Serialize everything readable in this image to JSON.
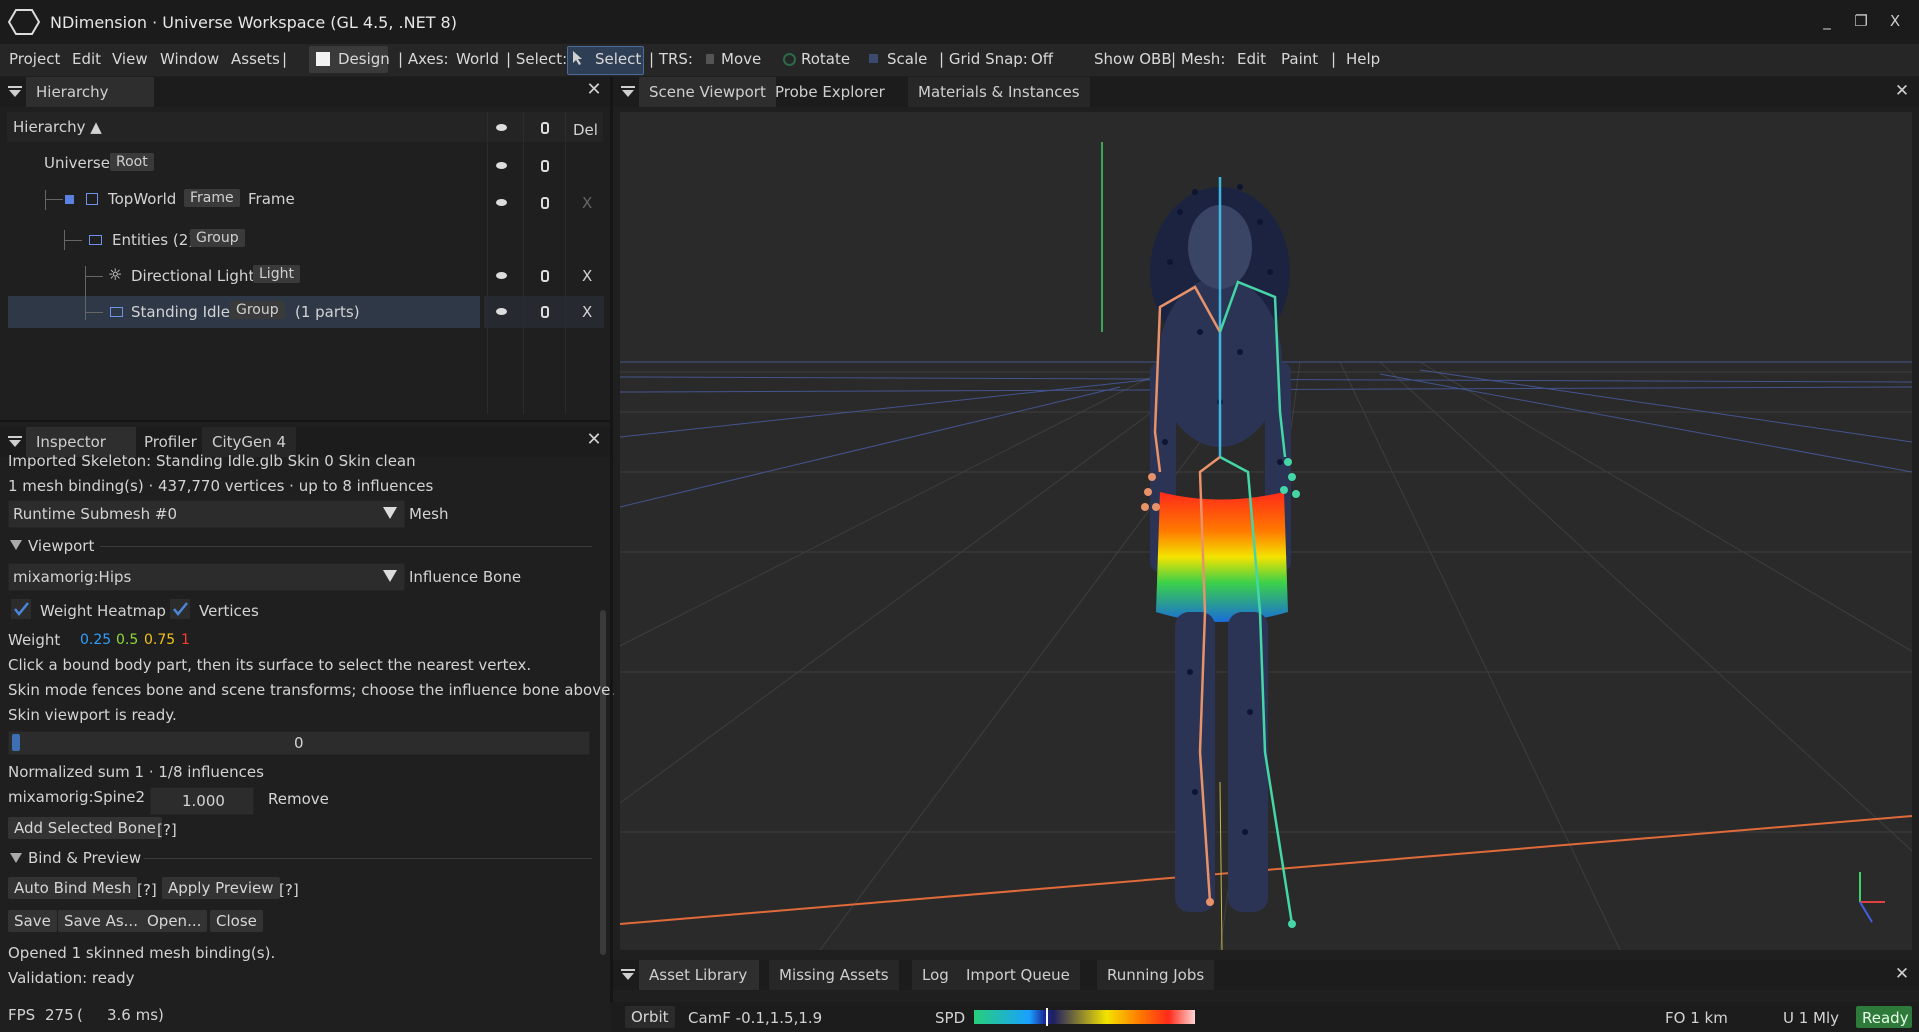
{
  "window": {
    "title": "NDimension · Universe Workspace (GL 4.5, .NET 8)",
    "minimize": "_",
    "restore": "❐",
    "close": "X"
  },
  "menu": {
    "project": "Project",
    "edit": "Edit",
    "view": "View",
    "window": "Window",
    "assets": "Assets",
    "sep": "|",
    "design": "Design",
    "axes_label": "| Axes:",
    "axes_value": "World",
    "select_label": "| Select:",
    "select_value": "Select",
    "trs_label": "| TRS:",
    "move": "Move",
    "rotate": "Rotate",
    "scale": "Scale",
    "grid_label": "| Grid Snap:",
    "grid_value": "Off",
    "show_obb": "Show OBB",
    "mesh_label": "| Mesh:",
    "mesh_edit": "Edit",
    "paint": "Paint",
    "help_sep": "|",
    "help": "Help"
  },
  "hierarchy": {
    "tab": "Hierarchy",
    "header": "Hierarchy ▲",
    "del": "Del",
    "rows": [
      {
        "name": "Universe",
        "chip": "Root",
        "extra": ""
      },
      {
        "name": "TopWorld",
        "chip": "Frame",
        "extra": "Frame",
        "x": "X"
      },
      {
        "name": "Entities (2)",
        "chip": "Group",
        "extra": ""
      },
      {
        "name": "Directional Light",
        "chip": "Light",
        "extra": "",
        "x": "X"
      },
      {
        "name": "Standing Idle",
        "chip": "Group",
        "extra": "(1 parts)",
        "x": "X"
      }
    ]
  },
  "inspector": {
    "tabs": [
      "Inspector",
      "Profiler",
      "CityGen 4"
    ],
    "skeleton_line": "Imported Skeleton: Standing Idle.glb Skin 0 Skin  clean",
    "binding_line": "1 mesh binding(s) · 437,770 vertices · up to 8 influences",
    "submesh_value": "Runtime Submesh #0",
    "submesh_label": "Mesh",
    "viewport_section": "Viewport",
    "bone_value": "mixamorig:Hips",
    "bone_label": "Influence Bone",
    "heatmap_label": "Weight Heatmap",
    "vertices_label": "Vertices",
    "weight_label": "Weight",
    "weight_stops": [
      {
        "label": "0.25",
        "color": "#2f9fff"
      },
      {
        "label": "0.5",
        "color": "#8fd93a"
      },
      {
        "label": "0.75",
        "color": "#f0c419"
      },
      {
        "label": "1",
        "color": "#ff3b30"
      }
    ],
    "help1": "Click a bound body part, then its surface to select the nearest vertex.",
    "help2": "Skin mode fences bone and scene transforms; choose the influence bone above.",
    "ready": "Skin viewport is ready.",
    "slider_value": "0",
    "normalized": "Normalized sum 1 · 1/8 influences",
    "influence_bone": "mixamorig:Spine2",
    "influence_weight": "1.000",
    "remove": "Remove",
    "add_selected": "Add Selected Bone",
    "q": "[?]",
    "bind_section": "Bind & Preview",
    "auto_bind": "Auto Bind Mesh",
    "apply_preview": "Apply Preview",
    "save": "Save",
    "save_as": "Save As...",
    "open": "Open...",
    "close": "Close",
    "opened": "Opened 1 skinned mesh binding(s).",
    "validation": "Validation: ready"
  },
  "fps": {
    "label": "FPS",
    "value": "275",
    "paren": "(",
    "ms": "3.6 ms)"
  },
  "viewport_tabs": [
    "Scene Viewport",
    "Probe Explorer",
    "Materials & Instances"
  ],
  "bottom_tabs": [
    "Asset Library",
    "Missing Assets",
    "Log",
    "Import Queue",
    "Running Jobs"
  ],
  "status": {
    "orbit": "Orbit",
    "cam": "CamF -0.1,1.5,1.9",
    "spd": "SPD",
    "fo": "FO 1 km",
    "u": "U 1 Mly",
    "ready": "Ready"
  },
  "colors": {
    "accent": "#4a6b99",
    "ready_bg": "#2d7a3a",
    "skeleton_left": "#e8926a",
    "skeleton_right": "#45d6a8"
  }
}
